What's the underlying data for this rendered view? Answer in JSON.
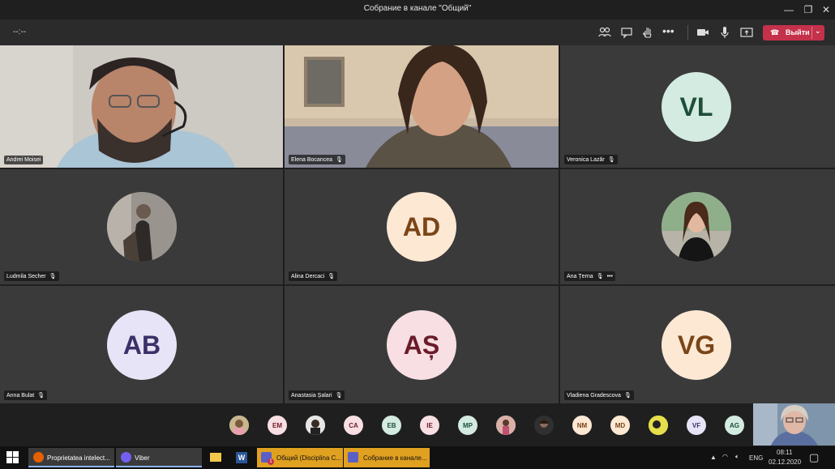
{
  "window": {
    "title": "Собрание в канале \"Общий\""
  },
  "toolbar": {
    "timer": "--:--",
    "leave_label": "Выйти"
  },
  "tiles": [
    {
      "name": "Andrei Moisei",
      "type": "video"
    },
    {
      "name": "Elena Bocancea",
      "type": "video"
    },
    {
      "name": "Veronica Lazăr",
      "initials": "VL",
      "type": "initials"
    },
    {
      "name": "Ludmila Secher",
      "type": "photo"
    },
    {
      "name": "Alina Dercaci",
      "initials": "AD",
      "type": "initials"
    },
    {
      "name": "Ana Țerna",
      "type": "photo"
    },
    {
      "name": "Anna Bulat",
      "initials": "AB",
      "type": "initials"
    },
    {
      "name": "Anastasia Șalari",
      "initials": "AȘ",
      "type": "initials"
    },
    {
      "name": "Vladiena Gradescova",
      "initials": "VG",
      "type": "initials"
    }
  ],
  "overflow": [
    "EM",
    "CA",
    "EB",
    "IE",
    "MP",
    "NM",
    "MD",
    "VF",
    "AG"
  ],
  "colors": {
    "leave": "#c4314b",
    "tile_bg": "#3a3a3a",
    "avatar_green": "#d3ebe0",
    "avatar_green_text": "#1d4e3a",
    "avatar_peach": "#fde8d4",
    "avatar_peach_text": "#7a4518",
    "avatar_lilac": "#e8e4f7",
    "avatar_lilac_text": "#3b3168",
    "avatar_pink": "#f8dfe3",
    "avatar_pink_text": "#6b1b2a"
  },
  "taskbar": {
    "items": [
      "Proprietatea intelect...",
      "Viber",
      "Общий (Disciplina C...",
      "Собрание в канале..."
    ],
    "badge": "1",
    "lang": "ENG",
    "time": "08:11",
    "date": "02.12.2020"
  }
}
